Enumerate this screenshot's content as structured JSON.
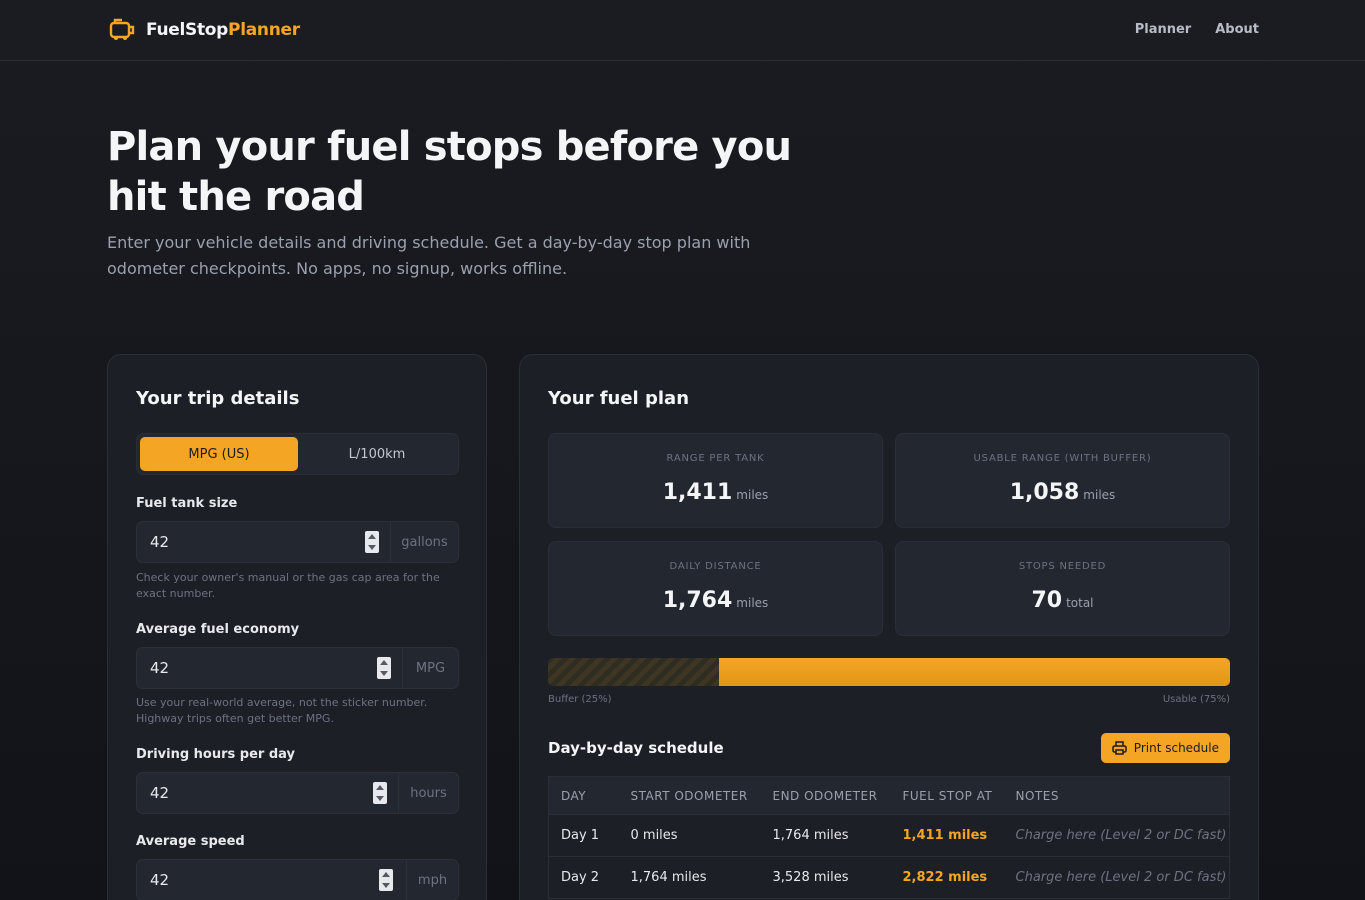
{
  "brand": {
    "name_part1": "FuelStop",
    "name_part2": "Planner"
  },
  "nav": {
    "planner": "Planner",
    "about": "About"
  },
  "hero": {
    "title": "Plan your fuel stops before you hit the road",
    "subtitle": "Enter your vehicle details and driving schedule. Get a day-by-day stop plan with odometer checkpoints. No apps, no signup, works offline."
  },
  "trip": {
    "title": "Your trip details",
    "units": {
      "mpg": "MPG (US)",
      "metric": "L/100km",
      "selected": "MPG (US)"
    },
    "tank": {
      "label": "Fuel tank size",
      "value": "42",
      "suffix": "gallons",
      "help": "Check your owner's manual or the gas cap area for the exact number."
    },
    "economy": {
      "label": "Average fuel economy",
      "value": "42",
      "suffix": "MPG",
      "help": "Use your real-world average, not the sticker number. Highway trips often get better MPG."
    },
    "hours": {
      "label": "Driving hours per day",
      "value": "42",
      "suffix": "hours"
    },
    "speed": {
      "label": "Average speed",
      "value": "42",
      "suffix": "mph"
    }
  },
  "plan": {
    "title": "Your fuel plan",
    "stats": {
      "range": {
        "label": "RANGE PER TANK",
        "value": "1,411",
        "unit": "miles"
      },
      "usable": {
        "label": "USABLE RANGE (WITH BUFFER)",
        "value": "1,058",
        "unit": "miles"
      },
      "daily": {
        "label": "DAILY DISTANCE",
        "value": "1,764",
        "unit": "miles"
      },
      "stops": {
        "label": "STOPS NEEDED",
        "value": "70",
        "unit": "total"
      }
    },
    "bar": {
      "buffer_fraction": 0.25,
      "buffer_label": "Buffer (25%)",
      "usable_label": "Usable (75%)"
    },
    "schedule": {
      "title": "Day-by-day schedule",
      "print_label": "Print schedule",
      "headers": {
        "day": "DAY",
        "start": "START ODOMETER",
        "end": "END ODOMETER",
        "stop": "FUEL STOP AT",
        "notes": "NOTES"
      },
      "rows": [
        {
          "day": "Day 1",
          "start": "0 miles",
          "end": "1,764 miles",
          "stop": "1,411 miles",
          "notes": "Charge here (Level 2 or DC fast)"
        },
        {
          "day": "Day 2",
          "start": "1,764 miles",
          "end": "3,528 miles",
          "stop": "2,822 miles",
          "notes": "Charge here (Level 2 or DC fast)"
        }
      ]
    }
  },
  "colors": {
    "accent": "#f5a524",
    "background": "#16181e",
    "card": "#1c1f26"
  },
  "icons": {
    "logo": "fuel-can-icon",
    "print": "printer-icon"
  }
}
